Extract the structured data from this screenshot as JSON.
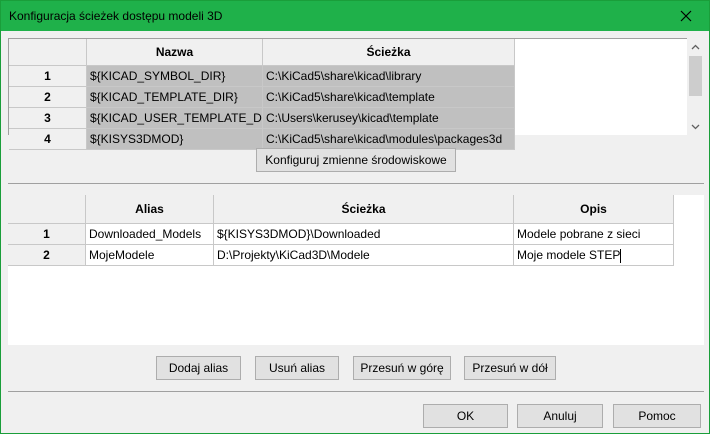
{
  "window": {
    "title": "Konfiguracja ścieżek dostępu modeli 3D"
  },
  "env_table": {
    "headers": [
      "Nazwa",
      "Ścieżka"
    ],
    "rows": [
      {
        "num": "1",
        "name": "${KICAD_SYMBOL_DIR}",
        "path": "C:\\KiCad5\\share\\kicad\\library"
      },
      {
        "num": "2",
        "name": "${KICAD_TEMPLATE_DIR}",
        "path": "C:\\KiCad5\\share\\kicad\\template"
      },
      {
        "num": "3",
        "name": "${KICAD_USER_TEMPLATE_DIR}",
        "path": "C:\\Users\\kerusey\\kicad\\template"
      },
      {
        "num": "4",
        "name": "${KISYS3DMOD}",
        "path": "C:\\KiCad5\\share\\kicad\\modules\\packages3d"
      }
    ]
  },
  "configure_env_button": "Konfiguruj zmienne środowiskowe",
  "alias_table": {
    "headers": [
      "Alias",
      "Ścieżka",
      "Opis"
    ],
    "rows": [
      {
        "num": "1",
        "alias": "Downloaded_Models",
        "path": "${KISYS3DMOD}\\Downloaded",
        "desc": "Modele pobrane z sieci"
      },
      {
        "num": "2",
        "alias": "MojeModele",
        "path": "D:\\Projekty\\KiCad3D\\Modele",
        "desc": "Moje modele STEP"
      }
    ]
  },
  "alias_buttons": {
    "add": "Dodaj alias",
    "remove": "Usuń alias",
    "move_up": "Przesuń w górę",
    "move_down": "Przesuń w dół"
  },
  "dialog_buttons": {
    "ok": "OK",
    "cancel": "Anuluj",
    "help": "Pomoc"
  }
}
